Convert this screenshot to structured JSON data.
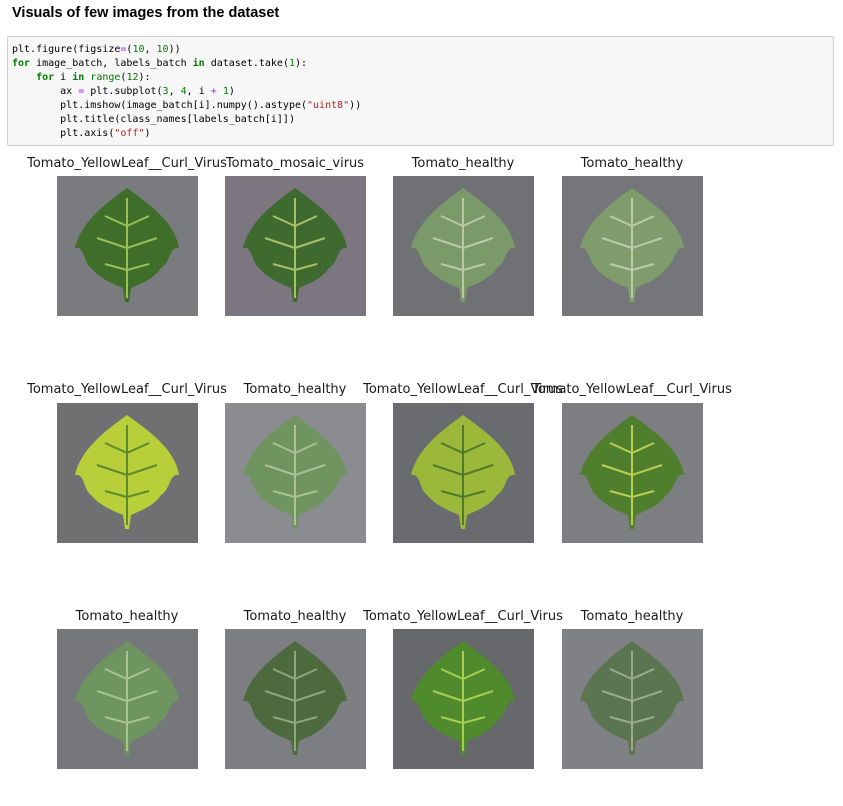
{
  "heading": "Visuals of few images from the dataset",
  "code_lines": [
    "plt.figure(figsize=(10, 10))",
    "for image_batch, labels_batch in dataset.take(1):",
    "    for i in range(12):",
    "        ax = plt.subplot(3, 4, i + 1)",
    "        plt.imshow(image_batch[i].numpy().astype(\"uint8\"))",
    "        plt.title(class_names[labels_batch[i]])",
    "        plt.axis(\"off\")"
  ],
  "images": [
    {
      "title": "Tomato_YellowLeaf__Curl_Virus",
      "leaf": "#3f6e2a",
      "vein": "#9bbf55",
      "bg": "#7a7b7e"
    },
    {
      "title": "Tomato_mosaic_virus",
      "leaf": "#3e6a2f",
      "vein": "#a8c068",
      "bg": "#7c7680"
    },
    {
      "title": "Tomato_healthy",
      "leaf": "#7b9a6a",
      "vein": "#b9c9a8",
      "bg": "#6f7174"
    },
    {
      "title": "Tomato_healthy",
      "leaf": "#7e9c6c",
      "vein": "#bccaab",
      "bg": "#74767a"
    },
    {
      "title": "Tomato_YellowLeaf__Curl_Virus",
      "leaf": "#b9cf3a",
      "vein": "#5e8a2e",
      "bg": "#6e7072"
    },
    {
      "title": "Tomato_healthy",
      "leaf": "#6f9460",
      "vein": "#a9c193",
      "bg": "#8a8c90"
    },
    {
      "title": "Tomato_YellowLeaf__Curl_Virus",
      "leaf": "#9cb83a",
      "vein": "#4f7a2a",
      "bg": "#6a6b6e"
    },
    {
      "title": "Tomato_YellowLeaf__Curl_Virus",
      "leaf": "#4f7f2d",
      "vein": "#b8cf52",
      "bg": "#7d7e81"
    },
    {
      "title": "Tomato_healthy",
      "leaf": "#6e9460",
      "vein": "#a8c290",
      "bg": "#75777b"
    },
    {
      "title": "Tomato_healthy",
      "leaf": "#4d6a3e",
      "vein": "#8ea77a",
      "bg": "#7d7e82"
    },
    {
      "title": "Tomato_YellowLeaf__Curl_Virus",
      "leaf": "#4f8b2c",
      "vein": "#a6cf52",
      "bg": "#66686b"
    },
    {
      "title": "Tomato_healthy",
      "leaf": "#5b7550",
      "vein": "#98ad88",
      "bg": "#808185"
    }
  ]
}
